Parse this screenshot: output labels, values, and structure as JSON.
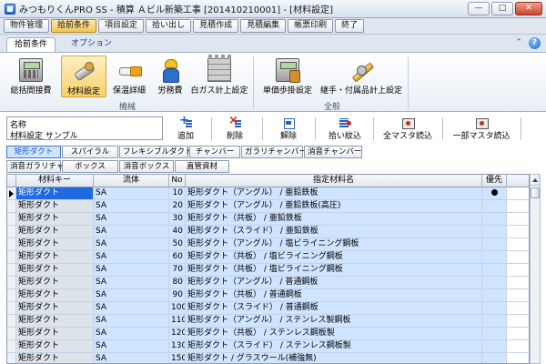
{
  "window": {
    "title": "みつもりくんPRO SS - 積算 Ａビル新築工事 [201410210001] - [材料設定]",
    "minimize": "—",
    "maximize": "□",
    "close": "✕"
  },
  "menu": [
    "物件管理",
    "拾前条件",
    "項目設定",
    "拾い出し",
    "見積作成",
    "見積編集",
    "帳票印刷",
    "終了"
  ],
  "ribbon": {
    "tabs": [
      "拾前条件",
      "オプション"
    ],
    "help": "?",
    "collapse": "⌃",
    "buttons": [
      {
        "label": "総括間接費",
        "icon": "calculator-icon"
      },
      {
        "label": "材料設定",
        "icon": "pipe-wrench-icon"
      },
      {
        "label": "保温詳細",
        "icon": "insulation-icon"
      },
      {
        "label": "労務費",
        "icon": "worker-icon"
      },
      {
        "label": "白ガス計上設定",
        "icon": "brick-wall-icon"
      },
      {
        "label": "単価歩掛設定",
        "icon": "price-calculator-icon"
      },
      {
        "label": "継手・付属品計上設定",
        "icon": "pipe-fitting-icon"
      }
    ],
    "groups": [
      "機械",
      "全般"
    ]
  },
  "name_panel": {
    "label": "名称",
    "value": "材料設定 サンプル"
  },
  "toolbar": [
    "追加",
    "削除",
    "解除",
    "拾い紋込",
    "全マスタ読込",
    "一部マスタ読込"
  ],
  "categories_row1": [
    "矩形ダクト",
    "スパイラル",
    "フレキシブルダクト",
    "チャンバー",
    "ガラリチャンバー",
    "消音チャンバー"
  ],
  "categories_row2": [
    "消音ガラリチャ",
    "ボックス",
    "消音ボックス",
    "直管資材"
  ],
  "grid": {
    "headers": [
      "材料キー",
      "流体",
      "No",
      "指定材料名",
      "優先"
    ],
    "rows": [
      {
        "key": "矩形ダクト",
        "fluid": "SA",
        "no": "10",
        "name": "矩形ダクト（アングル） / 亜鉛鉄板",
        "priority": "●"
      },
      {
        "key": "矩形ダクト",
        "fluid": "SA",
        "no": "20",
        "name": "矩形ダクト（アングル） / 亜鉛鉄板(高圧)",
        "priority": ""
      },
      {
        "key": "矩形ダクト",
        "fluid": "SA",
        "no": "30",
        "name": "矩形ダクト（共板） / 亜鉛鉄板",
        "priority": ""
      },
      {
        "key": "矩形ダクト",
        "fluid": "SA",
        "no": "40",
        "name": "矩形ダクト（スライド） / 亜鉛鉄板",
        "priority": ""
      },
      {
        "key": "矩形ダクト",
        "fluid": "SA",
        "no": "50",
        "name": "矩形ダクト（アングル） / 塩ビライニング鋼板",
        "priority": ""
      },
      {
        "key": "矩形ダクト",
        "fluid": "SA",
        "no": "60",
        "name": "矩形ダクト（共板） / 塩ビライニング鋼板",
        "priority": ""
      },
      {
        "key": "矩形ダクト",
        "fluid": "SA",
        "no": "70",
        "name": "矩形ダクト（共板） / 塩ビライニング鋼板",
        "priority": ""
      },
      {
        "key": "矩形ダクト",
        "fluid": "SA",
        "no": "80",
        "name": "矩形ダクト（アングル） / 普通鋼板",
        "priority": ""
      },
      {
        "key": "矩形ダクト",
        "fluid": "SA",
        "no": "90",
        "name": "矩形ダクト（共板） / 普通鋼板",
        "priority": ""
      },
      {
        "key": "矩形ダクト",
        "fluid": "SA",
        "no": "100",
        "name": "矩形ダクト（スライド） / 普通鋼板",
        "priority": ""
      },
      {
        "key": "矩形ダクト",
        "fluid": "SA",
        "no": "110",
        "name": "矩形ダクト（アングル） / ステンレス製鋼板",
        "priority": ""
      },
      {
        "key": "矩形ダクト",
        "fluid": "SA",
        "no": "120",
        "name": "矩形ダクト（共板） / ステンレス鋼板製",
        "priority": ""
      },
      {
        "key": "矩形ダクト",
        "fluid": "SA",
        "no": "130",
        "name": "矩形ダクト（スライド） / ステンレス鋼板製",
        "priority": ""
      },
      {
        "key": "矩形ダクト",
        "fluid": "SA",
        "no": "150",
        "name": "矩形ダクト / グラスウール(補強無)",
        "priority": ""
      }
    ]
  },
  "colors": {
    "accent": "#1f6ae0",
    "cell_bg": "#cfe4ff",
    "active_button": "#f7d06a"
  }
}
